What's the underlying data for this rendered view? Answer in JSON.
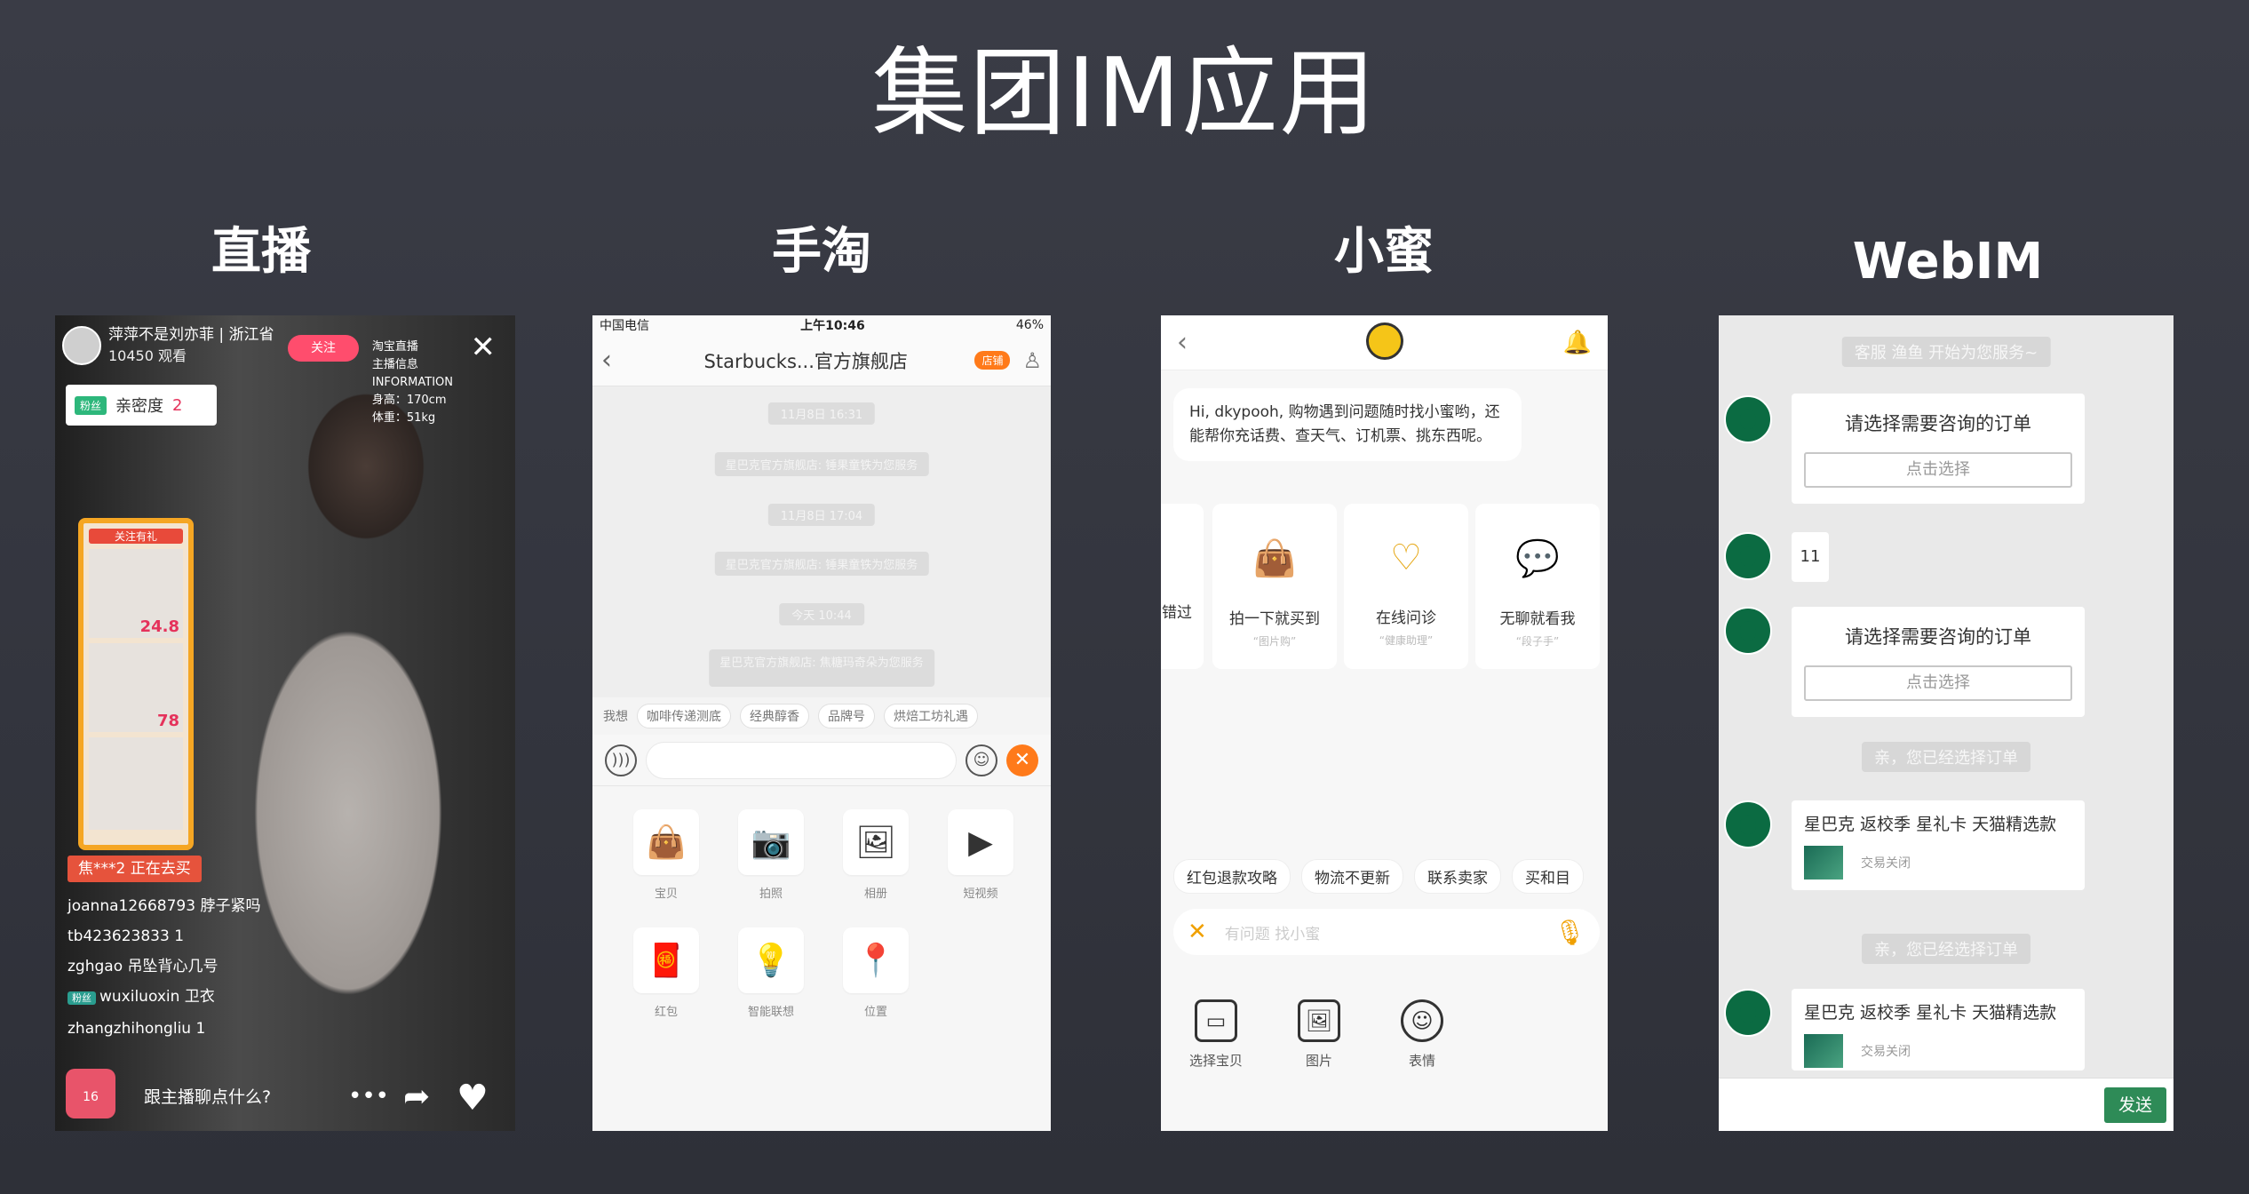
{
  "slide": {
    "title": "集团IM应用",
    "columns": [
      "直播",
      "手淘",
      "小蜜",
      "WebIM"
    ]
  },
  "live": {
    "host_name": "萍萍不是刘亦菲 | 浙江省",
    "viewers": "10450 观看",
    "follow_label": "关注",
    "host_info": [
      "淘宝直播",
      "主播信息",
      "INFORMATION",
      "身高：170cm",
      "体重：51kg"
    ],
    "intimacy_tag": "粉丝",
    "intimacy_label": "亲密度",
    "intimacy_value": "2",
    "goods_title": "关注有礼",
    "goods_prices": [
      "24.8",
      "78"
    ],
    "buying_banner": "焦***2 正在去买",
    "comments": [
      "joanna12668793 脖子紧吗",
      "tb423623833 1",
      "zghgao 吊坠背心几号",
      "wuxiluoxin 卫衣",
      "zhangzhihongliu 1"
    ],
    "comment_badge": "粉丝",
    "bag_count": "16",
    "chat_prompt": "跟主播聊点什么?",
    "more_icon": "more-icon",
    "share_icon": "share-icon",
    "heart_icon": "heart-icon"
  },
  "taobao": {
    "status_carrier": "中国电信",
    "status_time": "上午10:46",
    "status_battery": "46%",
    "title": "Starbucks...官方旗舰店",
    "shop_label": "店铺",
    "history": [
      {
        "kind": "time",
        "text": "11月8日 16:31"
      },
      {
        "kind": "msg",
        "text": "星巴克官方旗舰店: 锤果童铁为您服务"
      },
      {
        "kind": "time",
        "text": "11月8日 17:04"
      },
      {
        "kind": "msg",
        "text": "星巴克官方旗舰店: 锤果童铁为您服务"
      },
      {
        "kind": "time",
        "text": "今天 10:44"
      },
      {
        "kind": "msg",
        "text": "星巴克官方旗舰店: 焦糖玛奇朵为您服务"
      }
    ],
    "quick_prefix": "我想",
    "quick_replies": [
      "咖啡传递测底",
      "经典醇香",
      "品牌号",
      "烘焙工坊礼遇"
    ],
    "panel": [
      {
        "icon": "bag-icon",
        "glyph": "👜",
        "label": "宝贝"
      },
      {
        "icon": "camera-icon",
        "glyph": "📷",
        "label": "拍照"
      },
      {
        "icon": "image-icon",
        "glyph": "🖼",
        "label": "相册"
      },
      {
        "icon": "play-icon",
        "glyph": "▶",
        "label": "短视频"
      },
      {
        "icon": "red-packet-icon",
        "glyph": "🧧",
        "label": "红包"
      },
      {
        "icon": "bulb-icon",
        "glyph": "💡",
        "label": "智能联想"
      },
      {
        "icon": "location-icon",
        "glyph": "📍",
        "label": "位置"
      }
    ]
  },
  "xiaomi": {
    "greeting": "Hi, dkypooh, 购物遇到问题随时找小蜜哟，还能帮你充话费、查天气、订机票、挑东西呢。",
    "cards": [
      {
        "icon": "partial-icon",
        "glyph": "",
        "title": "错过",
        "sub": "“”"
      },
      {
        "icon": "shopping-bag-icon",
        "glyph": "👜",
        "title": "拍一下就买到",
        "sub": "“图片购”"
      },
      {
        "icon": "heart-pulse-icon",
        "glyph": "♡",
        "title": "在线问诊",
        "sub": "“健康助理”"
      },
      {
        "icon": "chat-bubble-icon",
        "glyph": "💬",
        "title": "无聊就看我",
        "sub": "“段子手”"
      }
    ],
    "quick_replies": [
      "红包退款攻略",
      "物流不更新",
      "联系卖家",
      "买和目"
    ],
    "input_placeholder": "有问题 找小蜜",
    "tools": [
      {
        "icon": "box-icon",
        "glyph": "▭",
        "label": "选择宝贝",
        "round": false
      },
      {
        "icon": "picture-icon",
        "glyph": "🖼",
        "label": "图片",
        "round": false
      },
      {
        "icon": "smile-icon",
        "glyph": "☺",
        "label": "表情",
        "round": true
      }
    ]
  },
  "webim": {
    "service_start": "客服 渔鱼 开始为您服务~",
    "order_prompt": "请选择需要咨询的订单",
    "choose_label": "点击选择",
    "user_msg": "11",
    "selected_notice": "亲，您已经选择订单",
    "product_title": "星巴克 返校季 星礼卡 天猫精选款",
    "trade_status": "交易关闭",
    "send_label": "发送"
  }
}
